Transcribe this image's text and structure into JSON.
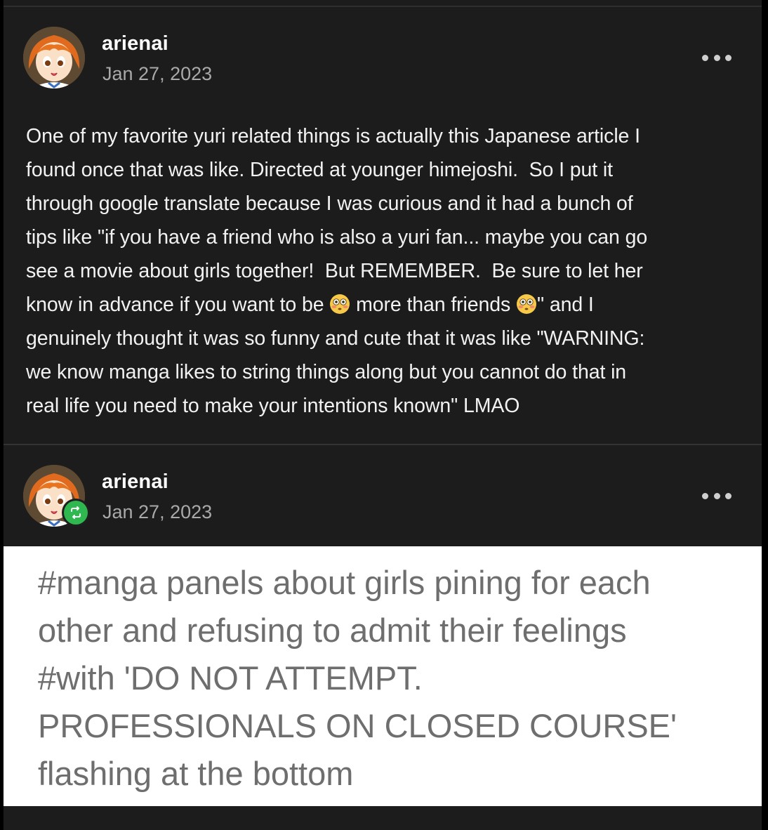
{
  "posts": [
    {
      "username": "arienai",
      "date": "Jan 27, 2023",
      "more_icon": "more-horizontal-icon",
      "avatar_icon": "anime-girl-avatar",
      "body_part1": "One of my favorite yuri related things is actually this Japanese article I\nfound once that was like. Directed at younger himejoshi.  So I put it\nthrough google translate because I was curious and it had a bunch of\ntips like \"if you have a friend who is also a yuri fan... maybe you can go\nsee a movie about girls together!  But REMEMBER.  Be sure to let her\nknow in advance if you want to be ",
      "body_part2": " more than friends ",
      "body_part3": "\" and I\ngenuinely thought it was so funny and cute that it was like \"WARNING:\nwe know manga likes to string things along but you cannot do that in\nreal life you need to make your intentions known\" LMAO",
      "emoji": "flushed-face-emoji"
    },
    {
      "username": "arienai",
      "date": "Jan 27, 2023",
      "more_icon": "more-horizontal-icon",
      "badge_icon": "reblog-icon",
      "badge_color": "#2fb84f",
      "tags_text": "#manga panels about girls pining for each\nother and refusing to admit their feelings\n#with 'DO NOT ATTEMPT.\nPROFESSIONALS ON CLOSED COURSE'\nflashing at the bottom"
    }
  ]
}
